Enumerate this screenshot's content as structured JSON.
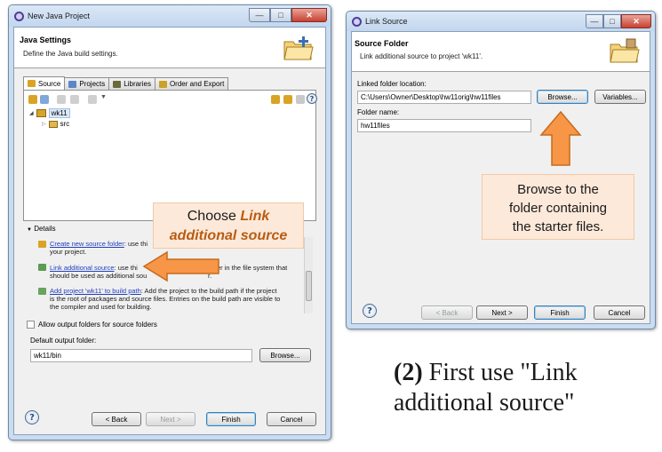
{
  "left_window": {
    "title": "New Java Project",
    "header_title": "Java Settings",
    "header_desc": "Define the Java build settings.",
    "tabs": [
      {
        "label": "Source",
        "color": "#d9a326"
      },
      {
        "label": "Projects",
        "color": "#5b87c7"
      },
      {
        "label": "Libraries",
        "color": "#6b6b3a"
      },
      {
        "label": "Order and Export",
        "color": "#c9a227"
      }
    ],
    "tree": {
      "project": "wk11",
      "child": "src"
    },
    "details_label": "Details",
    "details": {
      "item1_link": "Create new source folder",
      "item1_text_a": ": use thi",
      "item1_text_b": "your project.",
      "item2_link": "Link additional source",
      "item2_text_a": ": use thi",
      "item2_text_a2": "older in the file system that",
      "item2_text_b": "should be used as additional sou",
      "item2_text_b2": "r.",
      "item3_link": "Add project 'wk11' to build path",
      "item3_text_a": ": Add the project to the build path if the project",
      "item3_text_b": "is the root of packages and source files. Entries on the build path are visible to",
      "item3_text_c": "the compiler and used for building."
    },
    "allow_output_label": "Allow output folders for source folders",
    "output_folder_label": "Default output folder:",
    "output_folder_value": "wk11/bin",
    "browse_label": "Browse...",
    "buttons": {
      "back": "< Back",
      "next": "Next >",
      "finish": "Finish",
      "cancel": "Cancel"
    }
  },
  "right_window": {
    "title": "Link Source",
    "header_title": "Source Folder",
    "header_desc": "Link additional source to project 'wk11'.",
    "linked_location_label": "Linked folder location:",
    "linked_location_value": "C:\\Users\\Owner\\Desktop\\hw11orig\\hw11files",
    "browse_label": "Browse...",
    "variables_label": "Variables...",
    "folder_name_label": "Folder name:",
    "folder_name_value": "hw11files",
    "buttons": {
      "back": "< Back",
      "next": "Next >",
      "finish": "Finish",
      "cancel": "Cancel"
    }
  },
  "annotations": {
    "left_callout_line1": "Choose",
    "left_callout_line1_em": "Link",
    "left_callout_line2_em": "additional source",
    "right_callout_line1": "Browse to the",
    "right_callout_line2": "folder containing",
    "right_callout_line3": "the starter files.",
    "caption_num": "(2)",
    "caption_line1": " First use \"Link",
    "caption_line2": "additional source\""
  },
  "colors": {
    "arrow_fill": "#f79646",
    "arrow_stroke": "#c66a1c",
    "callout_bg": "#fde9d9",
    "emphasis_text": "#b85c12"
  }
}
